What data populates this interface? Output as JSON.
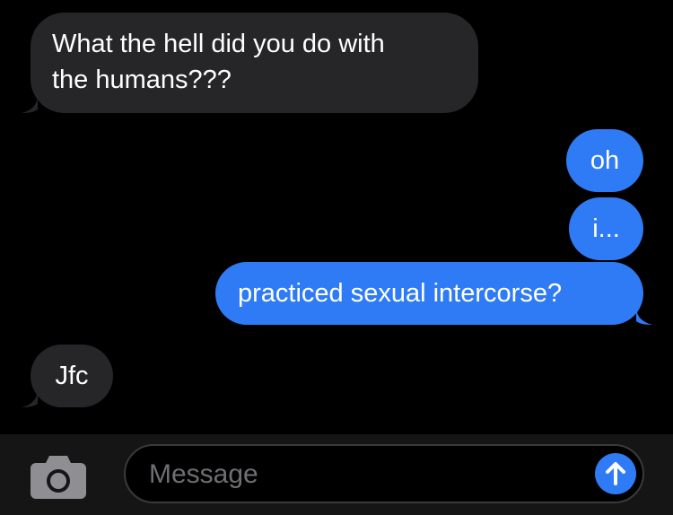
{
  "messages": [
    {
      "id": "m1",
      "direction": "incoming",
      "lines": [
        "What the hell did you do with",
        "the humans???"
      ]
    },
    {
      "id": "m2",
      "direction": "outgoing",
      "text": "oh"
    },
    {
      "id": "m3",
      "direction": "outgoing",
      "text": "i..."
    },
    {
      "id": "m4",
      "direction": "outgoing",
      "text": "practiced sexual intercorse?"
    },
    {
      "id": "m5",
      "direction": "incoming",
      "text": "Jfc"
    }
  ],
  "composer": {
    "placeholder": "Message",
    "camera_icon": "camera-icon",
    "send_icon": "send-arrow-up-icon"
  },
  "colors": {
    "background": "#000000",
    "incoming_bubble": "#262629",
    "outgoing_bubble": "#2f7bf5",
    "text": "#ffffff",
    "input_bar": "#151515",
    "placeholder": "#6f6f73"
  }
}
